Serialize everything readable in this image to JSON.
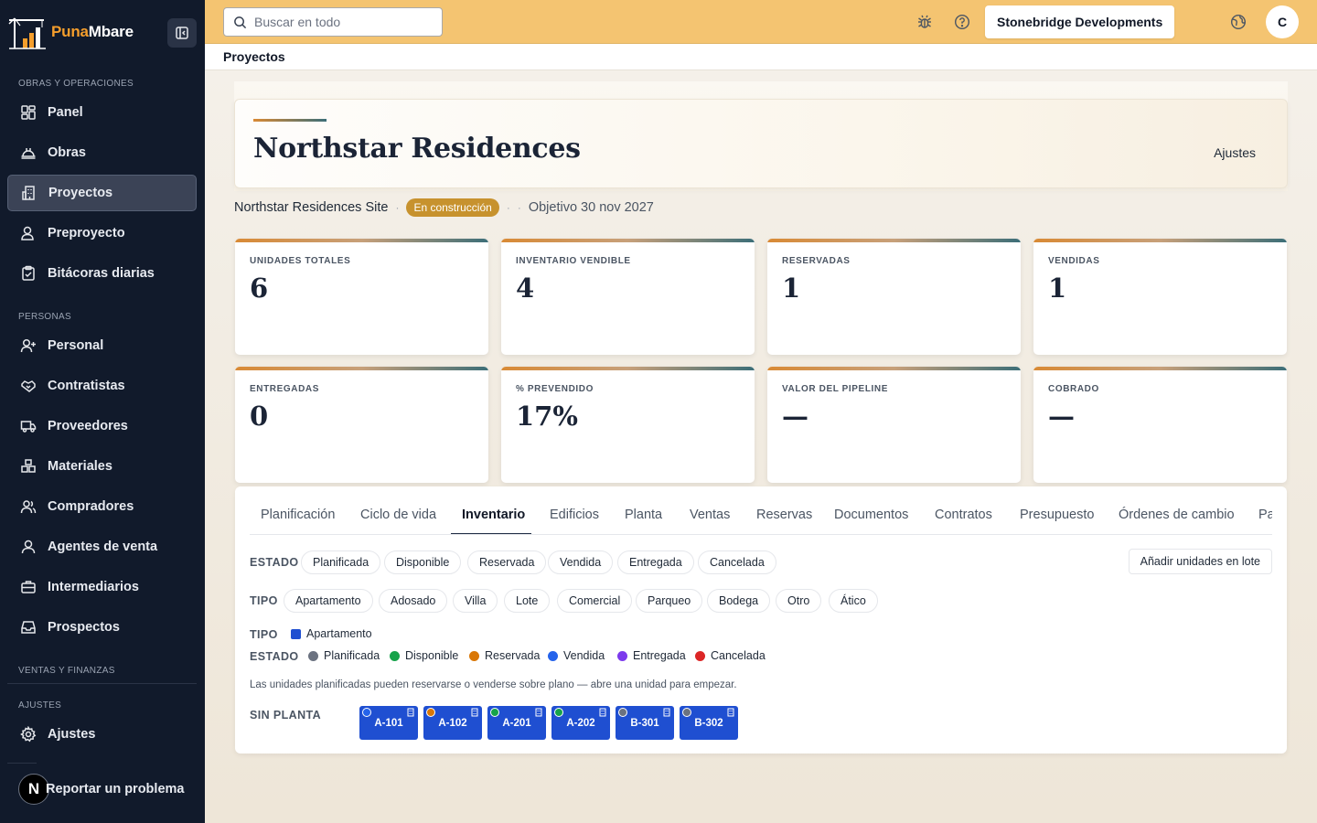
{
  "brand": {
    "name_part1": "Puna",
    "name_part2": "Mbare"
  },
  "sidebar": {
    "sections": {
      "obras": "OBRAS Y OPERACIONES",
      "personas": "PERSONAS",
      "ventas": "VENTAS Y FINANZAS",
      "ajustes": "AJUSTES"
    },
    "items": {
      "panel": "Panel",
      "obras": "Obras",
      "proyectos": "Proyectos",
      "preproyecto": "Preproyecto",
      "bitacoras": "Bitácoras diarias",
      "personal": "Personal",
      "contratistas": "Contratistas",
      "proveedores": "Proveedores",
      "materiales": "Materiales",
      "compradores": "Compradores",
      "agentes": "Agentes de venta",
      "intermediarios": "Intermediarios",
      "prospectos": "Prospectos",
      "ajustes": "Ajustes"
    },
    "report": {
      "badge": "N",
      "label": "Reportar un problema"
    }
  },
  "topbar": {
    "search_placeholder": "Buscar en todo",
    "company": "Stonebridge Developments",
    "avatar": "C"
  },
  "breadcrumb": "Proyectos",
  "project": {
    "title": "Northstar Residences",
    "settings": "Ajustes",
    "site": "Northstar Residences Site",
    "status": "En construcción",
    "target": "Objetivo 30 nov 2027"
  },
  "stats": [
    {
      "label": "UNIDADES TOTALES",
      "value": "6"
    },
    {
      "label": "INVENTARIO VENDIBLE",
      "value": "4"
    },
    {
      "label": "RESERVADAS",
      "value": "1"
    },
    {
      "label": "VENDIDAS",
      "value": "1"
    },
    {
      "label": "ENTREGADAS",
      "value": "0"
    },
    {
      "label": "% PREVENDIDO",
      "value": "17%"
    },
    {
      "label": "VALOR DEL PIPELINE",
      "value": "—"
    },
    {
      "label": "COBRADO",
      "value": "—"
    }
  ],
  "tabs": [
    "Planificación",
    "Ciclo de vida",
    "Inventario",
    "Edificios",
    "Planta",
    "Ventas",
    "Reservas",
    "Documentos",
    "Contratos",
    "Presupuesto",
    "Órdenes de cambio",
    "Pa"
  ],
  "inventory": {
    "estado_label": "ESTADO",
    "tipo_label": "TIPO",
    "estado_chips": [
      "Planificada",
      "Disponible",
      "Reservada",
      "Vendida",
      "Entregada",
      "Cancelada"
    ],
    "tipo_chips": [
      "Apartamento",
      "Adosado",
      "Villa",
      "Lote",
      "Comercial",
      "Parqueo",
      "Bodega",
      "Otro",
      "Ático"
    ],
    "bulk_button": "Añadir unidades en lote",
    "legend_tipo": [
      {
        "label": "Apartamento",
        "color": "#1f4fd1"
      }
    ],
    "legend_estado": [
      {
        "label": "Planificada",
        "color": "#6b7280"
      },
      {
        "label": "Disponible",
        "color": "#16a34a"
      },
      {
        "label": "Reservada",
        "color": "#d97706"
      },
      {
        "label": "Vendida",
        "color": "#2563eb"
      },
      {
        "label": "Entregada",
        "color": "#7c3aed"
      },
      {
        "label": "Cancelada",
        "color": "#dc2626"
      }
    ],
    "hint": "Las unidades planificadas pueden reservarse o venderse sobre plano — abre una unidad para empezar.",
    "sin_planta_label": "SIN PLANTA",
    "units": [
      {
        "code": "A-101",
        "status_color": "#2563eb"
      },
      {
        "code": "A-102",
        "status_color": "#d97706"
      },
      {
        "code": "A-201",
        "status_color": "#16a34a"
      },
      {
        "code": "A-202",
        "status_color": "#16a34a"
      },
      {
        "code": "B-301",
        "status_color": "#6b7280"
      },
      {
        "code": "B-302",
        "status_color": "#6b7280"
      }
    ]
  }
}
